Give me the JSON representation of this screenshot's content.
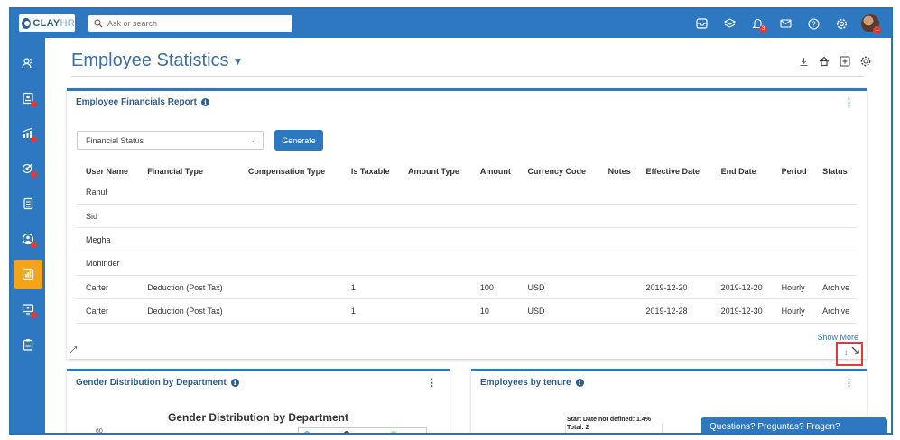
{
  "app": {
    "logo_brand": "CLAY",
    "logo_suffix": "HR",
    "search_placeholder": "Ask or search",
    "notification_count": "3",
    "avatar_badge": "1",
    "accent_color": "#2e78c2",
    "active_color": "#f2a51b"
  },
  "topbar_icons": [
    "inbox-icon",
    "layers-icon",
    "bell-icon",
    "mail-icon",
    "help-icon",
    "gear-icon"
  ],
  "sidebar": {
    "items": [
      {
        "icon": "users-icon",
        "dot": false,
        "active": false
      },
      {
        "icon": "user-card-icon",
        "dot": true,
        "active": false
      },
      {
        "icon": "performance-icon",
        "dot": true,
        "active": false
      },
      {
        "icon": "goals-icon",
        "dot": true,
        "active": false
      },
      {
        "icon": "documents-icon",
        "dot": false,
        "active": false
      },
      {
        "icon": "person-circle-icon",
        "dot": true,
        "active": false
      },
      {
        "icon": "reports-icon",
        "dot": false,
        "active": true
      },
      {
        "icon": "monitor-users-icon",
        "dot": true,
        "active": false
      },
      {
        "icon": "clipboard-icon",
        "dot": false,
        "active": false
      }
    ]
  },
  "page": {
    "title": "Employee Statistics",
    "actions": [
      "download-icon",
      "home-icon",
      "add-widget-icon",
      "settings-icon"
    ]
  },
  "financials_card": {
    "title": "Employee Financials Report",
    "select_value": "Financial Status",
    "generate_label": "Generate",
    "columns": [
      "User Name",
      "Financial Type",
      "Compensation Type",
      "Is Taxable",
      "Amount Type",
      "Amount",
      "Currency Code",
      "Notes",
      "Effective Date",
      "End Date",
      "Period",
      "Status"
    ],
    "rows": [
      [
        "Rahul",
        "",
        "",
        "",
        "",
        "",
        "",
        "",
        "",
        "",
        "",
        ""
      ],
      [
        "Sid",
        "",
        "",
        "",
        "",
        "",
        "",
        "",
        "",
        "",
        "",
        ""
      ],
      [
        "Megha",
        "",
        "",
        "",
        "",
        "",
        "",
        "",
        "",
        "",
        "",
        ""
      ],
      [
        "Mohinder",
        "",
        "",
        "",
        "",
        "",
        "",
        "",
        "",
        "",
        "",
        ""
      ],
      [
        "Carter",
        "Deduction (Post Tax)",
        "",
        "1",
        "",
        "100",
        "USD",
        "",
        "2019-12-20",
        "2019-12-20",
        "Hourly",
        "Archive"
      ],
      [
        "Carter",
        "Deduction (Post Tax)",
        "",
        "1",
        "",
        "10",
        "USD",
        "",
        "2019-12-28",
        "2019-12-30",
        "Hourly",
        "Archive"
      ]
    ],
    "show_more": "Show More"
  },
  "gender_card": {
    "title": "Gender Distribution by Department",
    "chart_title": "Gender Distribution by Department",
    "y_tick_visible": "60"
  },
  "tenure_card": {
    "title": "Employees by tenure",
    "note_line1": "Start Date not defined: 1.4%",
    "note_line2": "Total: 2"
  },
  "chat": {
    "label": "Questions? Preguntas? Fragen?"
  }
}
